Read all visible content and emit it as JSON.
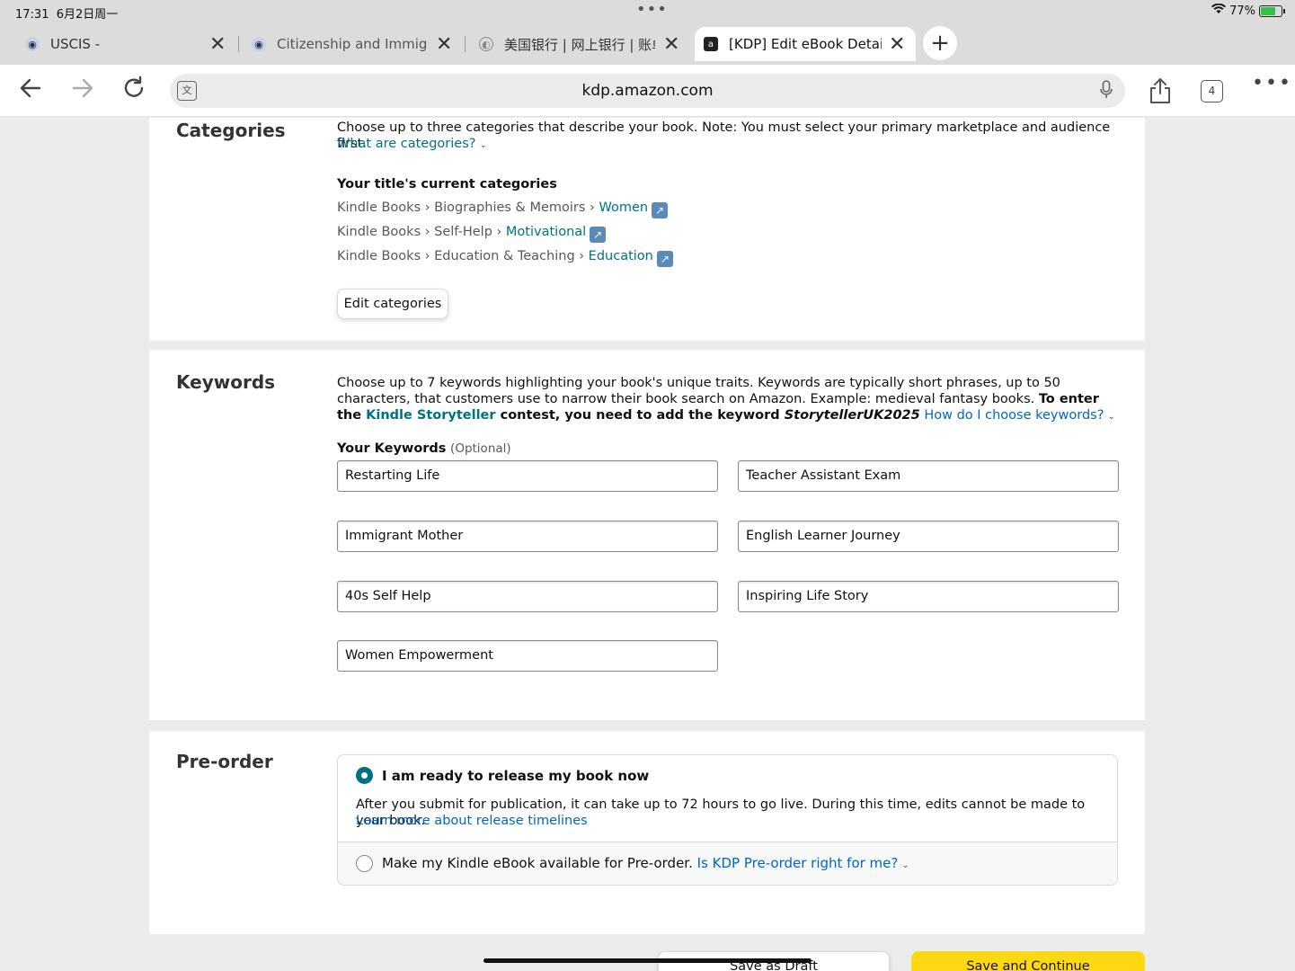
{
  "status_bar": {
    "time": "17:31",
    "date": "6月2日周一",
    "center_dots": "•••",
    "battery": "77%"
  },
  "tabs": [
    {
      "title": "USCIS -",
      "favicon": "seal-icon"
    },
    {
      "title": "Citizenship and Immigra",
      "favicon": "seal-icon"
    },
    {
      "title": "美国银行 | 网上银行 | 账单",
      "favicon": "globe-icon"
    },
    {
      "title": "[KDP] Edit eBook Details",
      "favicon": "amazon-kdp-icon"
    }
  ],
  "toolbar": {
    "url": "kdp.amazon.com",
    "tab_count": "4"
  },
  "categories": {
    "heading": "Categories",
    "description": "Choose up to three categories that describe your book. Note: You must select your primary marketplace and audience first.",
    "help_link": "What are categories?",
    "current_label": "Your title's current categories",
    "items": [
      {
        "path": "Kindle Books › Biographies & Memoirs › ",
        "leaf": "Women"
      },
      {
        "path": "Kindle Books › Self-Help › ",
        "leaf": "Motivational"
      },
      {
        "path": "Kindle Books › Education & Teaching › ",
        "leaf": "Education"
      }
    ],
    "edit_button": "Edit categories"
  },
  "keywords": {
    "heading": "Keywords",
    "desc_1": "Choose up to 7 keywords highlighting your book's unique traits. Keywords are typically short phrases, up to 50 characters, that customers use to narrow their book search on Amazon. Example: medieval fantasy books. ",
    "desc_bold_1": "To enter the ",
    "desc_contest_link": "Kindle Storyteller",
    "desc_bold_2": " contest, you need to add the keyword ",
    "desc_keyword": "StorytellerUK2025",
    "help_link": "How do I choose keywords?",
    "label": "Your Keywords",
    "optional": "(Optional)",
    "values": [
      "Restarting Life",
      "Teacher Assistant Exam",
      "Immigrant Mother",
      "English Learner Journey",
      "40s Self Help",
      "Inspiring Life Story",
      "Women Empowerment"
    ]
  },
  "preorder": {
    "heading": "Pre-order",
    "option_now": "I am ready to release my book now",
    "option_now_desc": "After you submit for publication, it can take up to 72 hours to go live. During this time, edits cannot be made to your book.",
    "option_now_link": "Learn more about release timelines",
    "option_pre": "Make my Kindle eBook available for Pre-order.",
    "option_pre_link": "Is KDP Pre-order right for me?",
    "selected": "now"
  },
  "footer": {
    "save_draft": "Save as Draft",
    "save_continue": "Save and Continue"
  }
}
